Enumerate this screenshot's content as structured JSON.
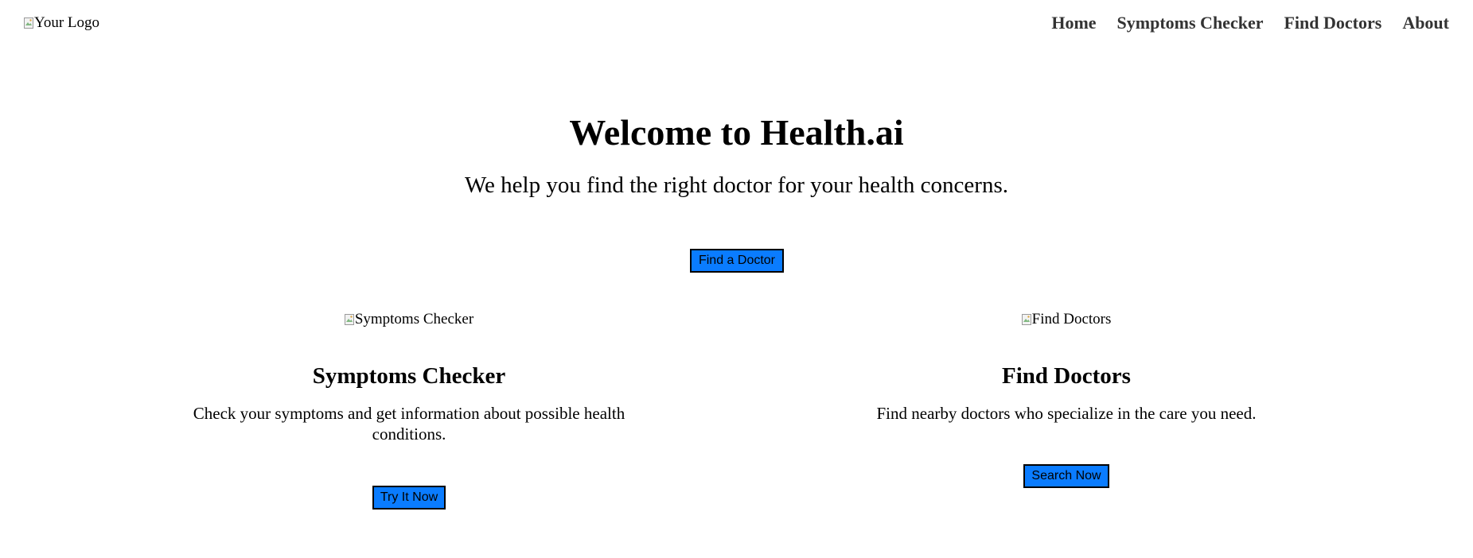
{
  "header": {
    "logo_alt": "Your Logo",
    "nav": [
      {
        "label": "Home"
      },
      {
        "label": "Symptoms Checker"
      },
      {
        "label": "Find Doctors"
      },
      {
        "label": "About"
      }
    ]
  },
  "hero": {
    "title": "Welcome to Health.ai",
    "subtitle": "We help you find the right doctor for your health concerns.",
    "button_label": "Find a Doctor"
  },
  "features": [
    {
      "image_alt": "Symptoms Checker",
      "title": "Symptoms Checker",
      "description": "Check your symptoms and get information about possible health conditions.",
      "button_label": "Try It Now"
    },
    {
      "image_alt": "Find Doctors",
      "title": "Find Doctors",
      "description": "Find nearby doctors who specialize in the care you need.",
      "button_label": "Search Now"
    }
  ],
  "colors": {
    "button_bg": "#0a7cff",
    "nav_text": "#333333",
    "text": "#000000"
  },
  "icons": {
    "broken_image": "broken-image-icon"
  }
}
